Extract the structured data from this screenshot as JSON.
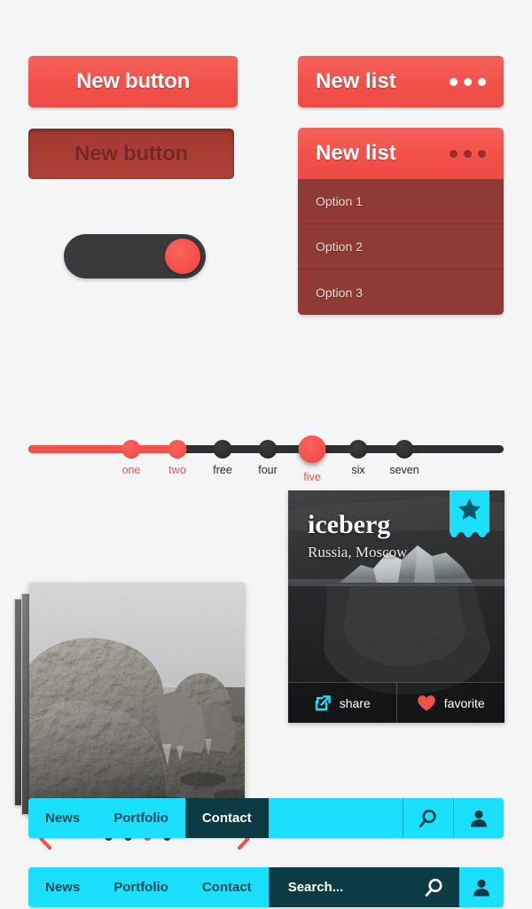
{
  "theme": {
    "background": "#f5f5f5",
    "accent_red": "#f4504a",
    "pressed_red": "#ab3d35",
    "list_body_red": "#8f3a34",
    "dark": "#2b2b2d",
    "cyan": "#1adfff",
    "dark_teal": "#0c3b44"
  },
  "buttons": {
    "normal": {
      "label": "New button"
    },
    "pressed": {
      "label": "New button"
    }
  },
  "toggle": {
    "state": "on"
  },
  "list_collapsed": {
    "title": "New list",
    "menu_icon": "ellipsis-icon"
  },
  "list_expanded": {
    "title": "New list",
    "menu_icon": "ellipsis-icon",
    "options": [
      {
        "label": "Option 1"
      },
      {
        "label": "Option 2"
      },
      {
        "label": "Option 3"
      }
    ]
  },
  "slider": {
    "stops": [
      {
        "label": "one",
        "state": "filled",
        "size": "small"
      },
      {
        "label": "two",
        "state": "filled",
        "size": "small"
      },
      {
        "label": "free",
        "state": "empty",
        "size": "small"
      },
      {
        "label": "four",
        "state": "empty",
        "size": "small"
      },
      {
        "label": "five",
        "state": "handle",
        "size": "large"
      },
      {
        "label": "six",
        "state": "empty",
        "size": "small"
      },
      {
        "label": "seven",
        "state": "empty",
        "size": "small"
      }
    ]
  },
  "carousel": {
    "prev_icon": "chevron-left-icon",
    "next_icon": "chevron-right-icon",
    "dots": [
      {
        "active": false
      },
      {
        "active": false
      },
      {
        "active": true
      },
      {
        "active": false
      }
    ]
  },
  "card": {
    "title": "iceberg",
    "subtitle": "Russia, Moscow",
    "ribbon_icon": "star-icon",
    "actions": [
      {
        "icon": "share-icon",
        "label": "share"
      },
      {
        "icon": "heart-icon",
        "label": "favorite"
      }
    ]
  },
  "navbar_compact": {
    "items": [
      {
        "label": "News",
        "active": false
      },
      {
        "label": "Portfolio",
        "active": false
      },
      {
        "label": "Contact",
        "active": true
      }
    ],
    "search_icon": "search-icon",
    "user_icon": "user-icon"
  },
  "navbar_search": {
    "items": [
      {
        "label": "News",
        "active": false
      },
      {
        "label": "Portfolio",
        "active": false
      },
      {
        "label": "Contact",
        "active": false
      }
    ],
    "search_placeholder": "Search...",
    "search_icon": "search-icon",
    "user_icon": "user-icon"
  }
}
